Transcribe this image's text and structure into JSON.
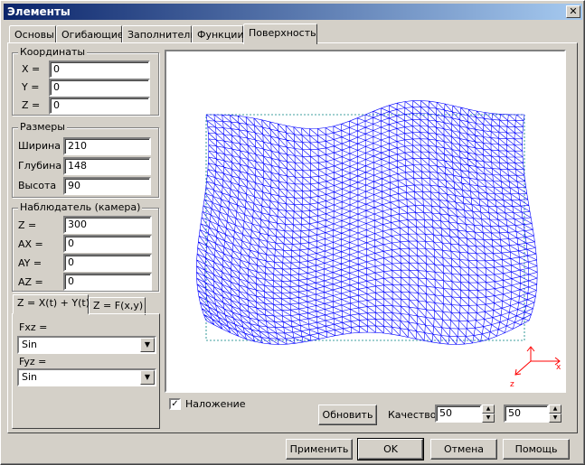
{
  "window": {
    "title": "Элементы",
    "close_glyph": "✕"
  },
  "tabs": [
    "Основы",
    "Огибающие",
    "Заполнители",
    "Функции",
    "Поверхность"
  ],
  "active_tab": "Поверхность",
  "coords": {
    "title": "Координаты",
    "x_label": "X =",
    "x": "0",
    "y_label": "Y =",
    "y": "0",
    "z_label": "Z =",
    "z": "0"
  },
  "sizes": {
    "title": "Размеры",
    "width_label": "Ширина",
    "width": "210",
    "depth_label": "Глубина",
    "depth": "148",
    "height_label": "Высота",
    "height": "90"
  },
  "camera": {
    "title": "Наблюдатель (камера)",
    "z_label": "Z =",
    "z": "300",
    "ax_label": "AX =",
    "ax": "0",
    "ay_label": "AY =",
    "ay": "0",
    "az_label": "AZ =",
    "az": "0"
  },
  "func_tabs": [
    "Z = X(t) + Y(t)",
    "Z = F(x,y)"
  ],
  "funcs": {
    "fxz_label": "Fxz =",
    "fxz": "Sin",
    "fyz_label": "Fyz =",
    "fyz": "Sin"
  },
  "overlay": {
    "label": "Наложение",
    "checked": true
  },
  "refresh_label": "Обновить",
  "quality": {
    "label": "Качество",
    "a": "50",
    "b": "50"
  },
  "axes": {
    "x": "x",
    "z": "z"
  },
  "buttons": {
    "apply": "Применить",
    "ok": "OK",
    "cancel": "Отмена",
    "help": "Помощь"
  },
  "colors": {
    "mesh": "#0000ff",
    "bbox": "#008080",
    "axis": "#ff0000",
    "title_start": "#0a246a",
    "title_end": "#a6caf0"
  }
}
